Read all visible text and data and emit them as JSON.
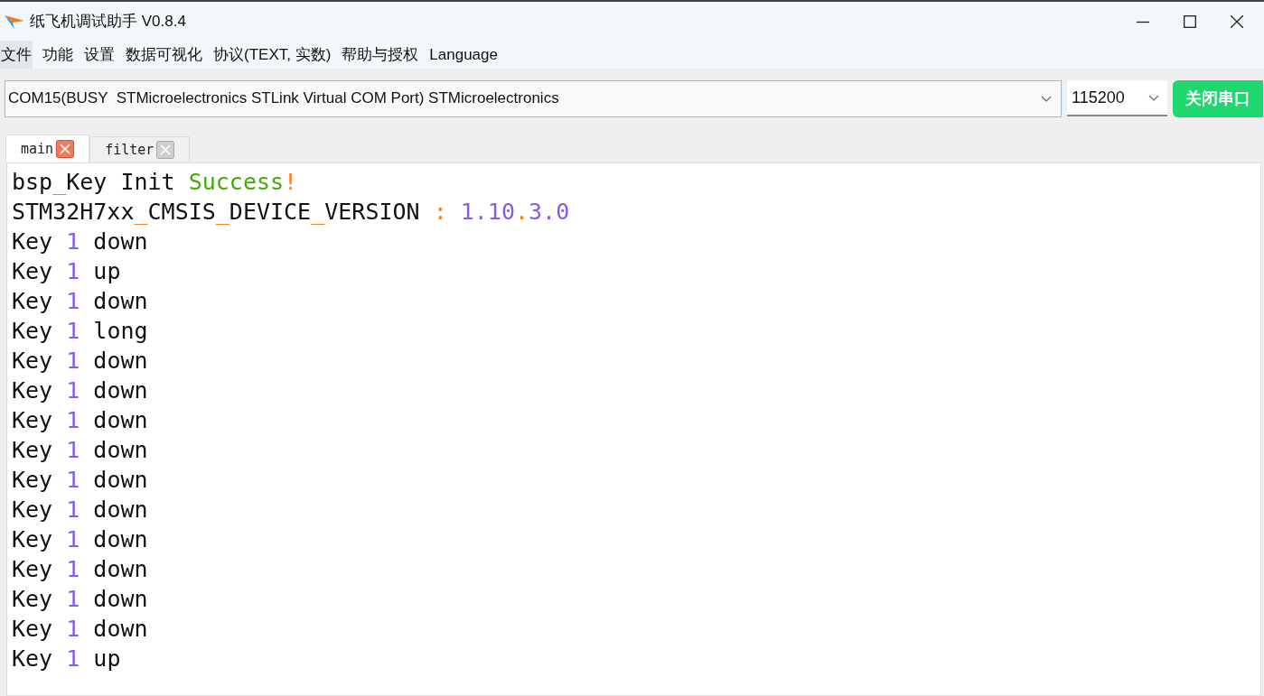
{
  "window": {
    "title": "纸飞机调试助手 V0.8.4"
  },
  "menu": [
    {
      "label": "文件",
      "selected": true
    },
    {
      "label": "功能",
      "selected": false
    },
    {
      "label": "设置",
      "selected": false
    },
    {
      "label": "数据可视化",
      "selected": false
    },
    {
      "label": "协议(TEXT, 实数)",
      "selected": false
    },
    {
      "label": "帮助与授权",
      "selected": false
    },
    {
      "label": "Language",
      "selected": false
    }
  ],
  "port_select": {
    "value": "COM15(BUSY  STMicroelectronics STLink Virtual COM Port) STMicroelectronics"
  },
  "baud_select": {
    "value": "115200"
  },
  "close_port_button": "关闭串口",
  "tabs": [
    {
      "label": "main",
      "selected": true
    },
    {
      "label": "filter",
      "selected": false
    }
  ],
  "log_lines": [
    [
      {
        "kind": "text",
        "text": "bsp"
      },
      {
        "kind": "symbol",
        "text": "_"
      },
      {
        "kind": "text",
        "text": "Key Init "
      },
      {
        "kind": "success",
        "text": "Success"
      },
      {
        "kind": "symbol",
        "text": "!"
      }
    ],
    [
      {
        "kind": "text",
        "text": "STM32H7xx"
      },
      {
        "kind": "symbol",
        "text": "_"
      },
      {
        "kind": "text",
        "text": "CMSIS"
      },
      {
        "kind": "symbol",
        "text": "_"
      },
      {
        "kind": "text",
        "text": "DEVICE"
      },
      {
        "kind": "symbol",
        "text": "_"
      },
      {
        "kind": "text",
        "text": "VERSION "
      },
      {
        "kind": "symbol",
        "text": ": "
      },
      {
        "kind": "number",
        "text": "1.10"
      },
      {
        "kind": "symbol",
        "text": "."
      },
      {
        "kind": "number",
        "text": "3.0"
      }
    ],
    [
      {
        "kind": "text",
        "text": "Key "
      },
      {
        "kind": "number",
        "text": "1"
      },
      {
        "kind": "text",
        "text": " down"
      }
    ],
    [
      {
        "kind": "text",
        "text": "Key "
      },
      {
        "kind": "number",
        "text": "1"
      },
      {
        "kind": "text",
        "text": " up"
      }
    ],
    [
      {
        "kind": "text",
        "text": "Key "
      },
      {
        "kind": "number",
        "text": "1"
      },
      {
        "kind": "text",
        "text": " down"
      }
    ],
    [
      {
        "kind": "text",
        "text": "Key "
      },
      {
        "kind": "number",
        "text": "1"
      },
      {
        "kind": "text",
        "text": " long"
      }
    ],
    [
      {
        "kind": "text",
        "text": "Key "
      },
      {
        "kind": "number",
        "text": "1"
      },
      {
        "kind": "text",
        "text": " down"
      }
    ],
    [
      {
        "kind": "text",
        "text": "Key "
      },
      {
        "kind": "number",
        "text": "1"
      },
      {
        "kind": "text",
        "text": " down"
      }
    ],
    [
      {
        "kind": "text",
        "text": "Key "
      },
      {
        "kind": "number",
        "text": "1"
      },
      {
        "kind": "text",
        "text": " down"
      }
    ],
    [
      {
        "kind": "text",
        "text": "Key "
      },
      {
        "kind": "number",
        "text": "1"
      },
      {
        "kind": "text",
        "text": " down"
      }
    ],
    [
      {
        "kind": "text",
        "text": "Key "
      },
      {
        "kind": "number",
        "text": "1"
      },
      {
        "kind": "text",
        "text": " down"
      }
    ],
    [
      {
        "kind": "text",
        "text": "Key "
      },
      {
        "kind": "number",
        "text": "1"
      },
      {
        "kind": "text",
        "text": " down"
      }
    ],
    [
      {
        "kind": "text",
        "text": "Key "
      },
      {
        "kind": "number",
        "text": "1"
      },
      {
        "kind": "text",
        "text": " down"
      }
    ],
    [
      {
        "kind": "text",
        "text": "Key "
      },
      {
        "kind": "number",
        "text": "1"
      },
      {
        "kind": "text",
        "text": " down"
      }
    ],
    [
      {
        "kind": "text",
        "text": "Key "
      },
      {
        "kind": "number",
        "text": "1"
      },
      {
        "kind": "text",
        "text": " down"
      }
    ],
    [
      {
        "kind": "text",
        "text": "Key "
      },
      {
        "kind": "number",
        "text": "1"
      },
      {
        "kind": "text",
        "text": " down"
      }
    ],
    [
      {
        "kind": "text",
        "text": "Key "
      },
      {
        "kind": "number",
        "text": "1"
      },
      {
        "kind": "text",
        "text": " up"
      }
    ]
  ]
}
